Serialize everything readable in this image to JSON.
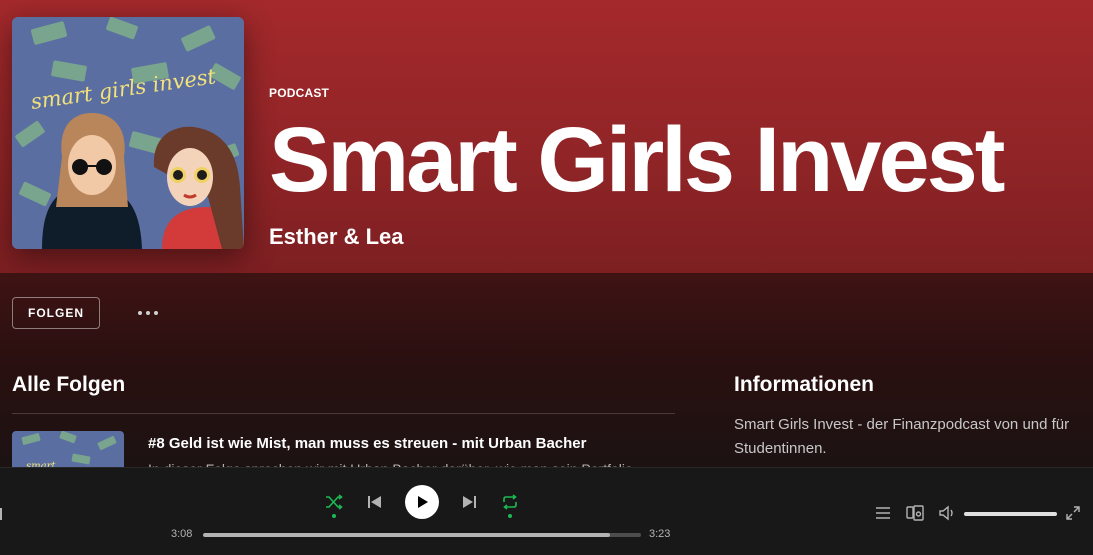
{
  "podcast": {
    "type_label": "PODCAST",
    "title": "Smart Girls Invest",
    "author": "Esther & Lea",
    "cover_text": "smart girls invest",
    "cover_bg": "#5b6ea1"
  },
  "actions": {
    "follow_label": "FOLGEN"
  },
  "episodes": {
    "section_title": "Alle Folgen",
    "items": [
      {
        "title": "#8 Geld ist wie Mist, man muss es streuen - mit Urban Bacher",
        "description": "In dieser Folge sprechen wir mit Urban Bacher darüber, wie man sein Portfolio"
      }
    ]
  },
  "info": {
    "section_title": "Informationen",
    "text": "Smart Girls Invest - der Finanzpodcast von und für Studentinnen."
  },
  "player": {
    "current_time": "3:08",
    "total_time": "3:23",
    "progress": 0.93,
    "volume": 1.0,
    "accent_color": "#1db954"
  },
  "icons": [
    "shuffle-icon",
    "previous-icon",
    "play-icon",
    "next-icon",
    "repeat-icon",
    "queue-icon",
    "devices-icon",
    "volume-icon",
    "fullscreen-icon",
    "more-icon"
  ]
}
